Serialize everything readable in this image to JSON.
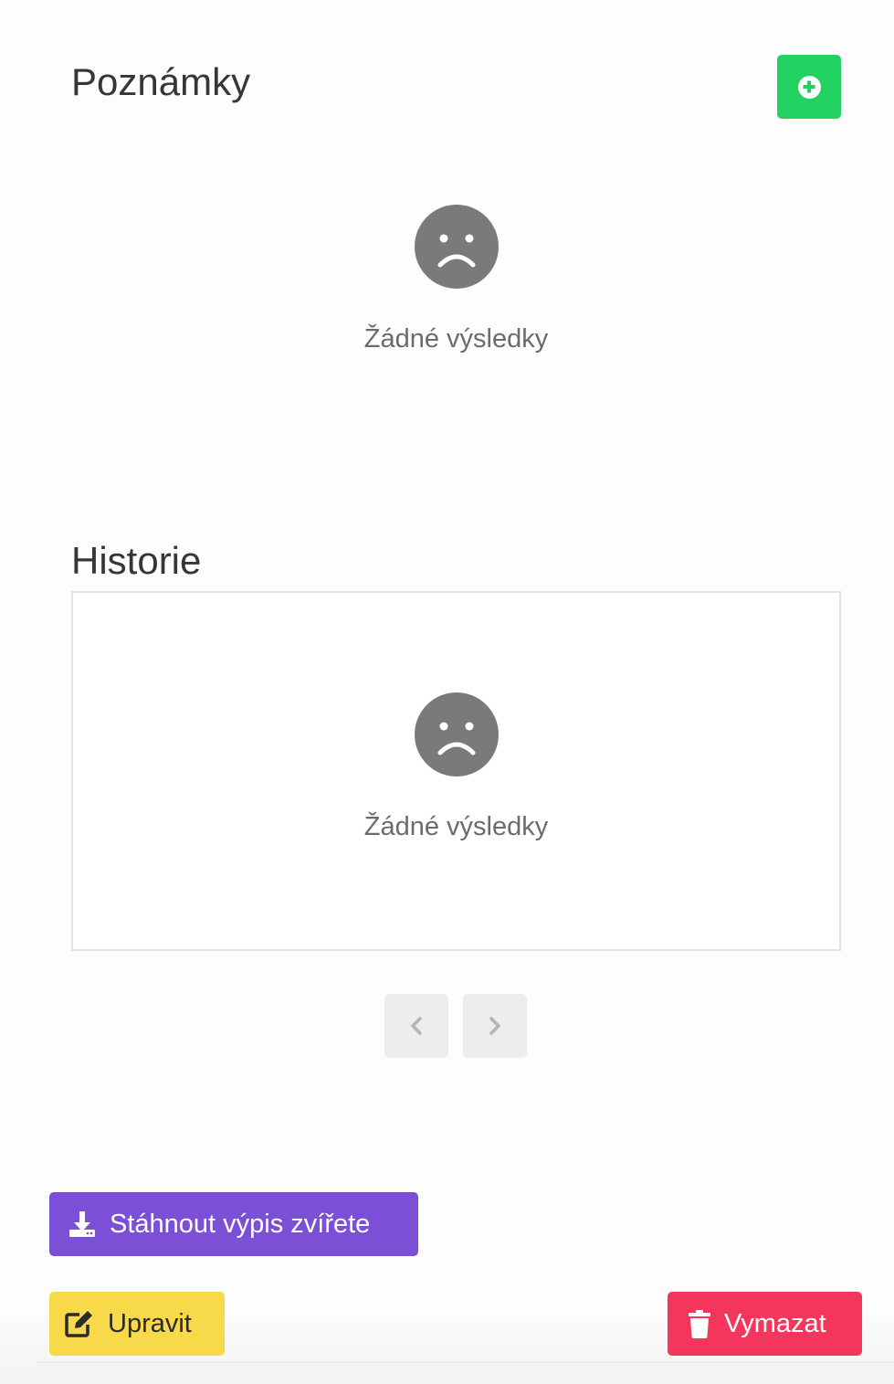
{
  "notes": {
    "title": "Poznámky",
    "add_button_icon": "plus-circle-icon",
    "empty_icon": "sad-face-icon",
    "empty_text": "Žádné výsledky"
  },
  "history": {
    "title": "Historie",
    "empty_icon": "sad-face-icon",
    "empty_text": "Žádné výsledky",
    "pagination": {
      "prev_icon": "chevron-left-icon",
      "next_icon": "chevron-right-icon"
    }
  },
  "actions": {
    "download_label": "Stáhnout výpis zvířete",
    "download_icon": "download-icon",
    "edit_label": "Upravit",
    "edit_icon": "edit-icon",
    "delete_label": "Vymazat",
    "delete_icon": "trash-icon"
  },
  "colors": {
    "add": "#23d160",
    "download": "#7b4fd6",
    "edit": "#f7d94a",
    "delete": "#f5365c",
    "empty_icon": "#7a7a7a"
  }
}
